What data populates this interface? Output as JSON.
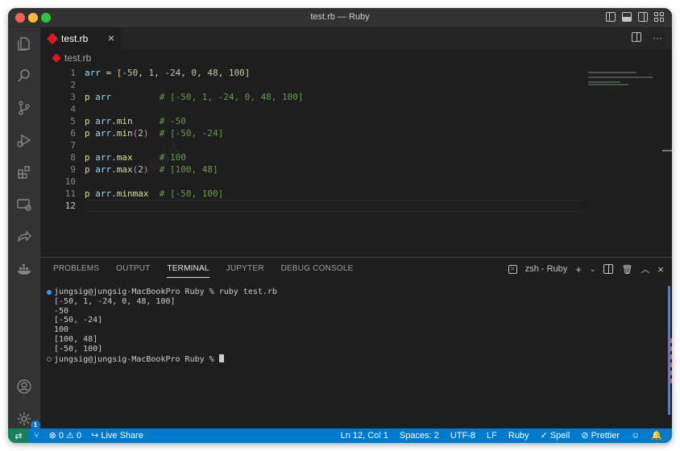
{
  "window": {
    "title": "test.rb — Ruby"
  },
  "tabs": [
    {
      "label": "test.rb",
      "close_glyph": "×"
    }
  ],
  "editor_actions": {
    "more_glyph": "···"
  },
  "breadcrumb": {
    "file": "test.rb"
  },
  "editor": {
    "line_numbers": [
      "1",
      "2",
      "3",
      "4",
      "5",
      "6",
      "7",
      "8",
      "9",
      "10",
      "11",
      "12"
    ],
    "current_line": 12,
    "lines": [
      "arr = [-50, 1, -24, 0, 48, 100]",
      "",
      "p arr         # [-50, 1, -24, 0, 48, 100]",
      "",
      "p arr.min     # -50",
      "p arr.min(2)  # [-50, -24]",
      "",
      "p arr.max     # 100",
      "p arr.max(2)  # [100, 48]",
      "",
      "p arr.minmax  # [-50, 100]",
      ""
    ]
  },
  "panel": {
    "tabs": [
      "PROBLEMS",
      "OUTPUT",
      "TERMINAL",
      "JUPYTER",
      "DEBUG CONSOLE"
    ],
    "active_tab": "TERMINAL",
    "terminal_name": "zsh - Ruby",
    "terminal_lines": [
      "jungsig@jungsig-MacBookPro Ruby % ruby test.rb",
      "[-50, 1, -24, 0, 48, 100]",
      "-50",
      "[-50, -24]",
      "100",
      "[100, 48]",
      "[-50, 100]",
      "jungsig@jungsig-MacBookPro Ruby % "
    ]
  },
  "activity": {
    "settings_badge": "1"
  },
  "statusbar": {
    "problems": "⊗ 0 ⚠ 0",
    "live_share": "Live Share",
    "cursor_position": "Ln 12, Col 1",
    "indentation": "Spaces: 2",
    "encoding": "UTF-8",
    "eol": "LF",
    "language": "Ruby",
    "spell": "Spell",
    "prettier": "Prettier"
  },
  "colors": {
    "accent": "#007acc",
    "remote": "#16825d",
    "ruby": "#e51521"
  }
}
